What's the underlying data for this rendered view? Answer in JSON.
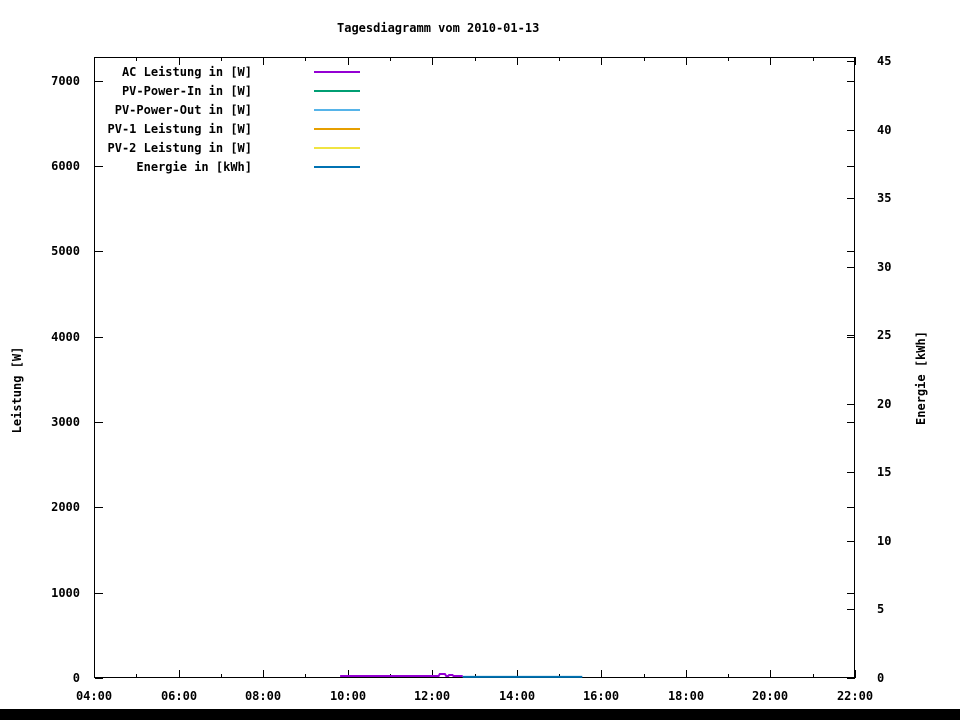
{
  "chart_data": {
    "type": "line",
    "title": "Tagesdiagramm vom 2010-01-13",
    "ylabel": "Leistung [W]",
    "y2label": "Energie [kWh]",
    "grid": false,
    "legend_position": "top-left-inside",
    "background": "#ffffff",
    "x_axis": {
      "unit": "time-of-day",
      "start_hour": 4,
      "end_hour": 22,
      "major_tick_hours": [
        4,
        6,
        8,
        10,
        12,
        14,
        16,
        18,
        20,
        22
      ],
      "minor_tick_hours": [
        5,
        7,
        9,
        11,
        13,
        15,
        17,
        19,
        21
      ],
      "tick_labels": [
        "04:00",
        "06:00",
        "08:00",
        "10:00",
        "12:00",
        "14:00",
        "16:00",
        "18:00",
        "20:00",
        "22:00"
      ]
    },
    "y_left": {
      "label": "Leistung [W]",
      "ticks": [
        0,
        1000,
        2000,
        3000,
        4000,
        5000,
        6000,
        7000
      ],
      "tick_labels": [
        "0",
        "1000",
        "2000",
        "3000",
        "4000",
        "5000",
        "6000",
        "7000"
      ],
      "min": 0,
      "max": 7280
    },
    "y_right": {
      "label": "Energie [kWh]",
      "ticks": [
        0,
        5,
        10,
        15,
        20,
        25,
        30,
        35,
        40,
        45
      ],
      "tick_labels": [
        "0",
        "5",
        "10",
        "15",
        "20",
        "25",
        "30",
        "35",
        "40",
        "45"
      ],
      "min": 0,
      "max": 45.3
    },
    "legend": [
      {
        "label": "AC Leistung in [W]",
        "color": "#9400d3"
      },
      {
        "label": "PV-Power-In in [W]",
        "color": "#009e73"
      },
      {
        "label": "PV-Power-Out in [W]",
        "color": "#56b4e9"
      },
      {
        "label": "PV-1 Leistung in [W]",
        "color": "#e69f00"
      },
      {
        "label": "PV-2 Leistung in [W]",
        "color": "#f0e442"
      },
      {
        "label": "Energie in [kWh]",
        "color": "#0072b2"
      }
    ],
    "series": [
      {
        "name": "AC Leistung in [W]",
        "color": "#9400d3",
        "axis": "left",
        "points": [
          [
            9.82,
            23
          ],
          [
            12.15,
            23
          ],
          [
            12.18,
            47
          ],
          [
            12.3,
            47
          ],
          [
            12.33,
            23
          ],
          [
            12.38,
            23
          ],
          [
            12.4,
            35
          ],
          [
            12.48,
            35
          ],
          [
            12.5,
            23
          ],
          [
            12.72,
            23
          ]
        ]
      },
      {
        "name": "Energie in [kWh]",
        "color": "#0072b2",
        "axis": "right",
        "points": [
          [
            12.72,
            0.08
          ],
          [
            15.55,
            0.08
          ]
        ]
      }
    ]
  }
}
